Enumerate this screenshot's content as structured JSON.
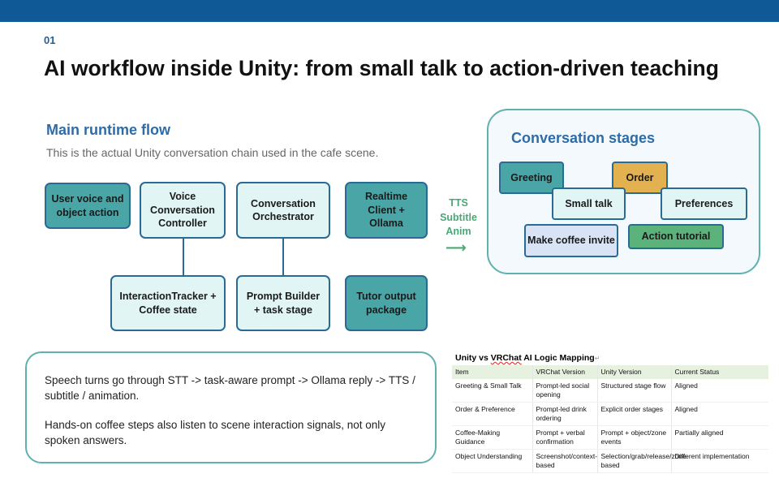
{
  "slide": {
    "number": "01",
    "title": "AI workflow inside Unity: from small talk to action-driven teaching"
  },
  "flow": {
    "title": "Main runtime flow",
    "subtitle": "This is the actual Unity conversation chain used in the cafe scene.",
    "nodes": {
      "user_voice": "User voice and object action",
      "voice_controller": "Voice Conversation Controller",
      "orchestrator": "Conversation Orchestrator",
      "realtime_client": "Realtime Client + Ollama",
      "interaction_tracker": "InteractionTracker + Coffee state",
      "prompt_builder": "Prompt Builder + task stage",
      "tutor_output": "Tutor output package"
    },
    "tts_label": "TTS Subtitle Anim",
    "arrow": "⟶"
  },
  "stages": {
    "title": "Conversation stages",
    "chips": {
      "greeting": "Greeting",
      "order": "Order",
      "small_talk": "Small talk",
      "preferences": "Preferences",
      "make_coffee": "Make coffee invite",
      "action_tutorial": "Action tutorial"
    }
  },
  "note": {
    "p1": "Speech turns go through STT -> task-aware prompt -> Ollama reply -> TTS / subtitle / animation.",
    "p2": "Hands-on coffee steps also listen to scene interaction signals, not only spoken answers."
  },
  "mapping_table": {
    "title_plain": "Unity vs ",
    "title_squiggle": "VRChat",
    "title_rest": " AI Logic Mapping",
    "headers": [
      "Item",
      "VRChat Version",
      "Unity Version",
      "Current Status"
    ],
    "rows": [
      [
        "Greeting & Small Talk",
        "Prompt-led social opening",
        "Structured stage flow",
        "Aligned"
      ],
      [
        "Order & Preference",
        "Prompt-led drink ordering",
        "Explicit order stages",
        "Aligned"
      ],
      [
        "Coffee-Making Guidance",
        "Prompt + verbal confirmation",
        "Prompt + object/zone events",
        "Partially aligned"
      ],
      [
        "Object Understanding",
        "Screenshot/context-based",
        "Selection/grab/release/zone-based",
        "Different implementation"
      ]
    ]
  },
  "colors": {
    "topbar": "#0f5a96",
    "title_blue": "#2e6ca8",
    "node_light": "#e2f5f5",
    "node_dark": "#4aa5a6",
    "node_border": "#2a6b95",
    "accent_green": "#4aa877",
    "chip_orange": "#e4b150",
    "chip_lavender": "#d8e4f5",
    "chip_green": "#5bb27a",
    "box_border": "#5fb1ad"
  }
}
